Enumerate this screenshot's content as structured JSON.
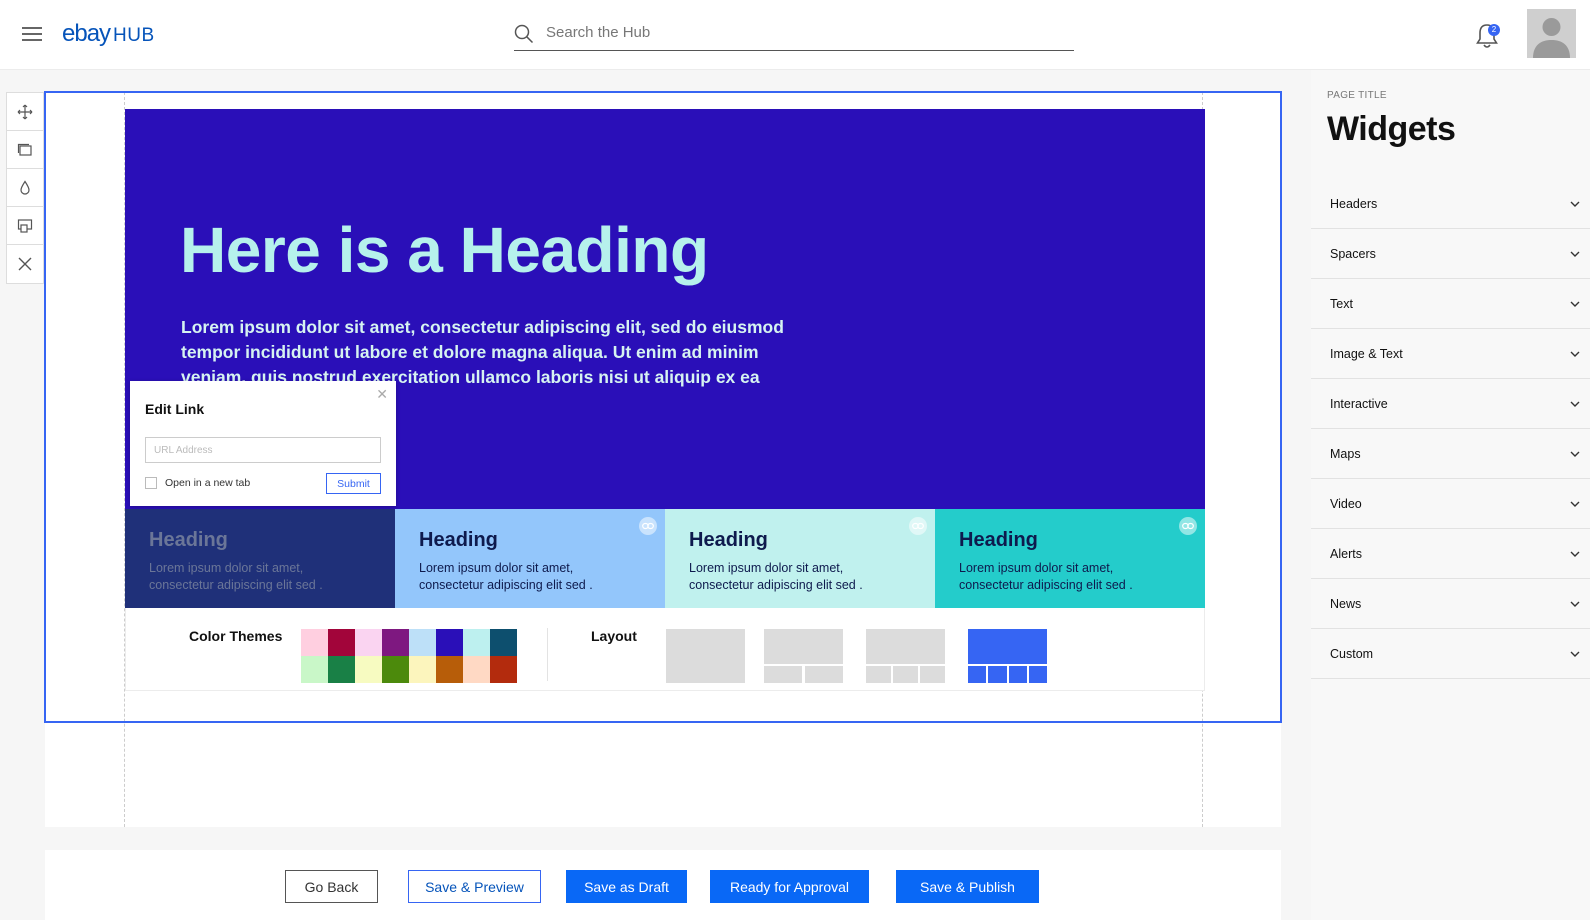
{
  "app": {
    "logo_text": "ebay",
    "logo_suffix": "HUB",
    "notification_count": "2"
  },
  "search": {
    "placeholder": "Search the Hub"
  },
  "toolbar": {
    "tools": [
      "move-icon",
      "duplicate-icon",
      "color-drop-icon",
      "layout-icon",
      "close-icon"
    ]
  },
  "hero": {
    "heading": "Here is a Heading",
    "body": "Lorem ipsum dolor sit amet, consectetur adipiscing elit, sed do eiusmod tempor incididunt ut labore et dolore magna aliqua. Ut enim ad minim veniam, quis nostrud exercitation ullamco laboris nisi ut aliquip ex ea",
    "background": "#2a0fb8",
    "heading_color": "#b6f1ec"
  },
  "edit_link": {
    "title": "Edit Link",
    "url_placeholder": "URL Address",
    "new_tab_label": "Open in a new tab",
    "submit_label": "Submit"
  },
  "cards": [
    {
      "heading": "Heading",
      "body": "Lorem ipsum dolor sit amet, consectetur adipiscing elit sed .",
      "bg": "#1f3079",
      "fg": "#6b7698"
    },
    {
      "heading": "Heading",
      "body": "Lorem ipsum dolor sit amet, consectetur adipiscing elit sed .",
      "bg": "#93c6fb",
      "fg": "#0e1a4d"
    },
    {
      "heading": "Heading",
      "body": "Lorem ipsum dolor sit amet, consectetur adipiscing elit sed .",
      "bg": "#c0f1ee",
      "fg": "#0e1a4d"
    },
    {
      "heading": "Heading",
      "body": "Lorem ipsum dolor sit amet, consectetur adipiscing elit sed .",
      "bg": "#24cccb",
      "fg": "#0e1a4d"
    }
  ],
  "options": {
    "color_themes_label": "Color Themes",
    "layout_label": "Layout",
    "swatches_top": [
      "#ffcfe0",
      "#a2053a",
      "#fad4f1",
      "#7e1880",
      "#bde0f8",
      "#2a0fb8",
      "#bdf0ef",
      "#0d4f6e"
    ],
    "swatches_bottom": [
      "#c9f7c8",
      "#198046",
      "#f7fbc1",
      "#4c8a0c",
      "#fcf5bd",
      "#b75d09",
      "#ffd9c4",
      "#b32b0d"
    ]
  },
  "actions": {
    "go_back": "Go Back",
    "save_preview": "Save & Preview",
    "save_draft": "Save as Draft",
    "ready_approval": "Ready for Approval",
    "save_publish": "Save & Publish"
  },
  "panel": {
    "caption": "PAGE TITLE",
    "title": "Widgets",
    "items": [
      "Headers",
      "Spacers",
      "Text",
      "Image & Text",
      "Interactive",
      "Maps",
      "Video",
      "Alerts",
      "News",
      "Custom"
    ]
  }
}
